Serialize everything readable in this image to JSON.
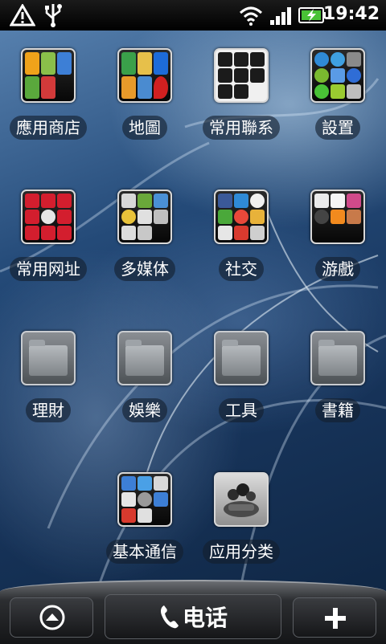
{
  "status_bar": {
    "time": "19:42",
    "icons": [
      "warning-icon",
      "usb-icon",
      "wifi-icon",
      "signal-icon",
      "battery-charging-icon"
    ]
  },
  "folders": [
    {
      "label": "應用商店",
      "kind": "app"
    },
    {
      "label": "地圖",
      "kind": "app"
    },
    {
      "label": "常用聯系",
      "kind": "contacts"
    },
    {
      "label": "設置",
      "kind": "app"
    },
    {
      "label": "常用网址",
      "kind": "app"
    },
    {
      "label": "多媒体",
      "kind": "app"
    },
    {
      "label": "社交",
      "kind": "app"
    },
    {
      "label": "游戲",
      "kind": "app"
    },
    {
      "label": "理財",
      "kind": "empty"
    },
    {
      "label": "娛樂",
      "kind": "empty"
    },
    {
      "label": "工具",
      "kind": "empty"
    },
    {
      "label": "書籍",
      "kind": "empty"
    },
    {
      "label": "基本通信",
      "kind": "app"
    },
    {
      "label": "应用分类",
      "kind": "single"
    }
  ],
  "dock": {
    "phone_label": "电话",
    "left_icon": "up-arrow-circle-icon",
    "right_icon": "plus-icon"
  }
}
